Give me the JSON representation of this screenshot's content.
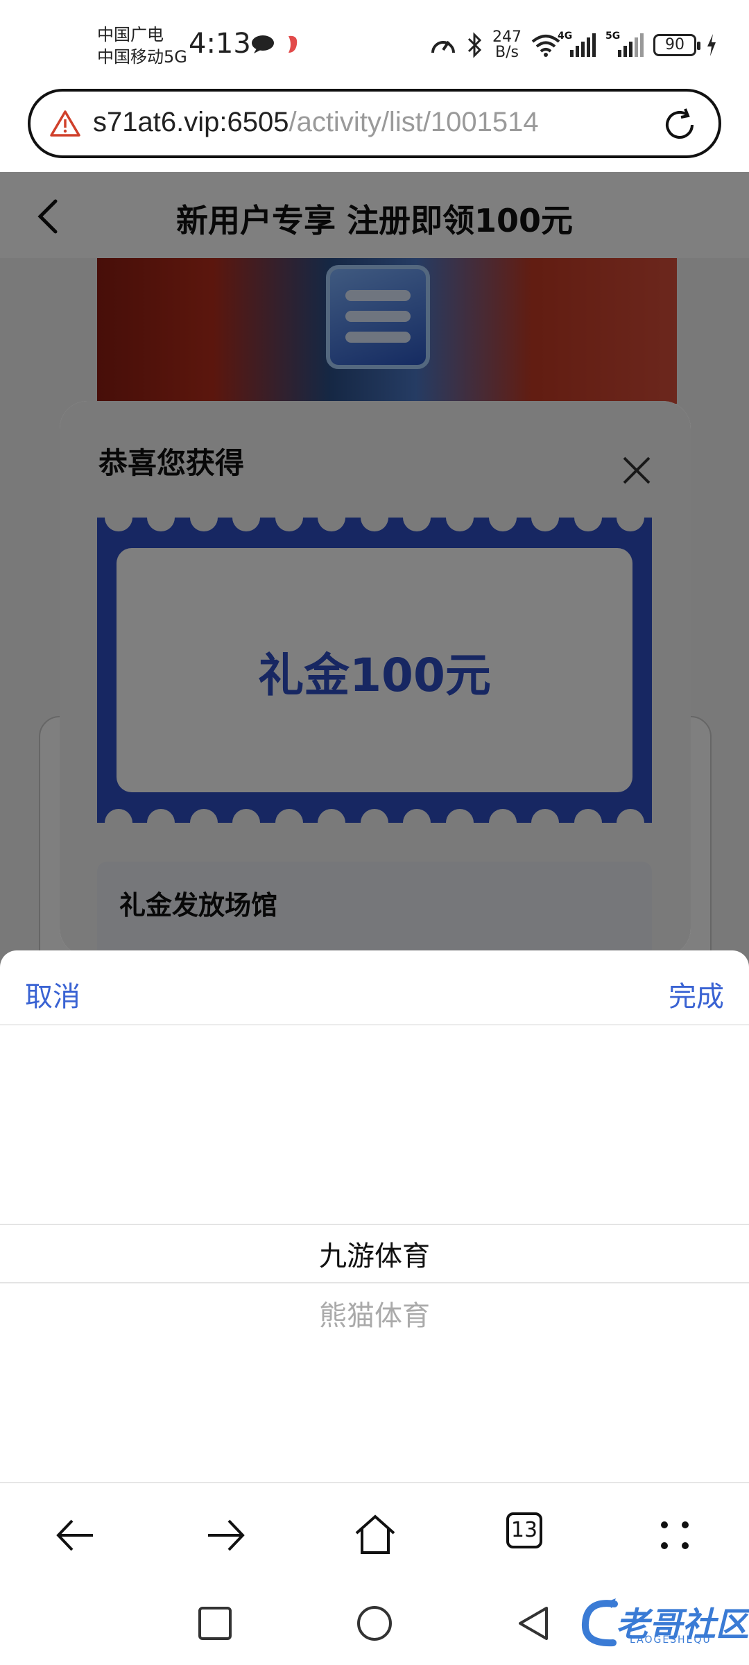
{
  "status_bar": {
    "carrier_line1": "中国广电",
    "carrier_line2": "中国移动5G",
    "time": "4:13",
    "net_speed_value": "247",
    "net_speed_unit": "B/s",
    "signal1_label": "4G",
    "signal2_label": "5G",
    "battery": "90"
  },
  "browser": {
    "url_host": "s71at6.vip:6505",
    "url_path": "/activity/list/1001514",
    "tab_count": "13"
  },
  "page": {
    "title": "新用户专享 注册即领100元"
  },
  "modal": {
    "title": "恭喜您获得",
    "coupon_text": "礼金100元",
    "venue_label": "礼金发放场馆"
  },
  "picker": {
    "cancel_label": "取消",
    "done_label": "完成",
    "options": [
      "九游体育",
      "熊猫体育"
    ],
    "selected_index": 0
  },
  "watermark": {
    "text": "老哥社区",
    "subtext": "LAOGESHEQU"
  },
  "colors": {
    "accent": "#3a63d3",
    "coupon_blue": "#2f4fc4",
    "overlay": "rgba(0,0,0,0.5)"
  },
  "icons": [
    "warning-icon",
    "reload-icon",
    "back-icon",
    "close-icon",
    "chat-icon",
    "bluetooth-icon",
    "wifi-icon"
  ]
}
